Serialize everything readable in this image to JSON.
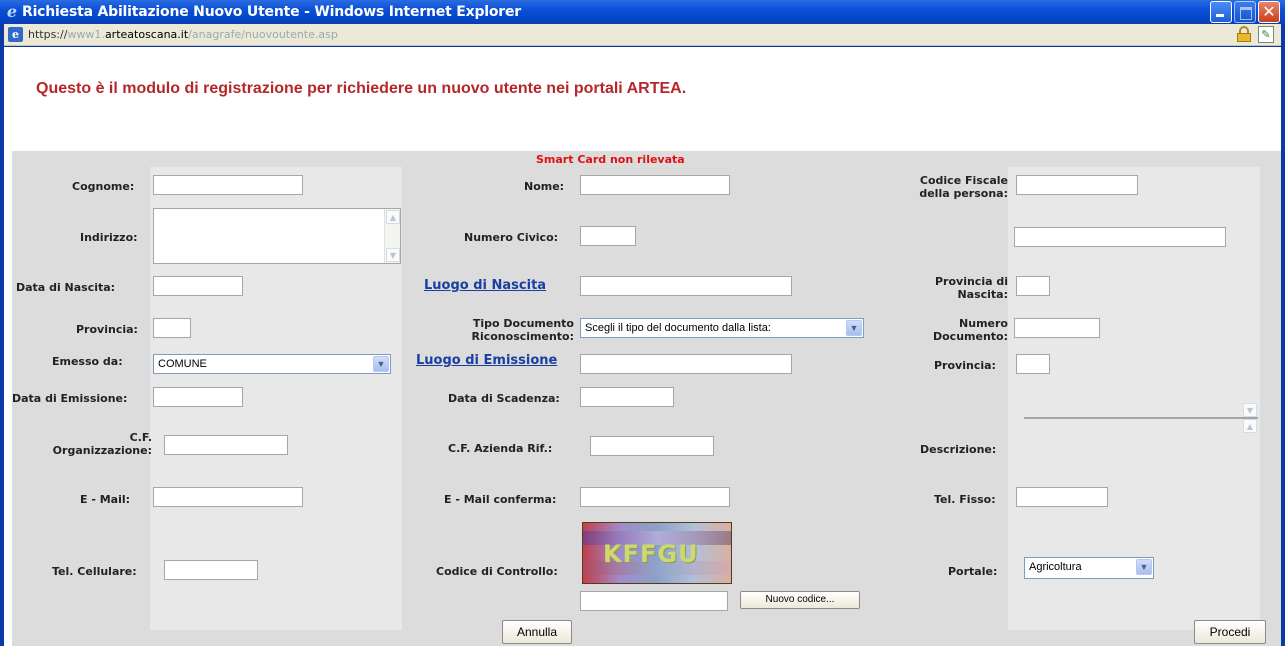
{
  "window": {
    "title": "Richiesta Abilitazione Nuovo Utente - Windows Internet Explorer",
    "icon": "ie-icon"
  },
  "address": {
    "scheme": "https://",
    "prefix": "www1.",
    "domain": "arteatoscana.it",
    "path": "/anagrafe/nuovoutente.asp"
  },
  "page": {
    "heading": "Questo è il modulo di registrazione per richiedere un nuovo utente nei portali ARTEA.",
    "smartcard_status": "Smart Card non rilevata",
    "status_color": "#e01010",
    "heading_color": "#b5272a"
  },
  "form": {
    "cognome": "Cognome:",
    "nome": "Nome:",
    "codice_fiscale": "Codice Fiscale della persona:",
    "indirizzo": "Indirizzo:",
    "numero_civico": "Numero Civico:",
    "data_nascita": "Data di Nascita:",
    "luogo_nascita": "Luogo di Nascita",
    "provincia_nascita": "Provincia di Nascita:",
    "provincia": "Provincia:",
    "tipo_documento": "Tipo Documento Riconoscimento:",
    "tipo_documento_value": "Scegli il tipo del documento dalla lista:",
    "numero_documento": "Numero Documento:",
    "emesso_da": "Emesso da:",
    "emesso_da_value": "COMUNE",
    "luogo_emissione": "Luogo di Emissione",
    "provincia2": "Provincia:",
    "data_emissione": "Data di Emissione:",
    "data_scadenza": "Data di Scadenza:",
    "cf_organizzazione": "C.F. Organizzazione:",
    "cf_azienda": "C.F. Azienda Rif.:",
    "descrizione": "Descrizione:",
    "email": "E - Mail:",
    "email_conferma": "E - Mail conferma:",
    "tel_fisso": "Tel. Fisso:",
    "tel_cellulare": "Tel. Cellulare:",
    "codice_controllo": "Codice di Controllo:",
    "captcha_text": "KFFGU",
    "nuovo_codice": "Nuovo codice...",
    "portale": "Portale:",
    "portale_value": "Agricoltura",
    "annulla": "Annulla",
    "procedi": "Procedi"
  }
}
